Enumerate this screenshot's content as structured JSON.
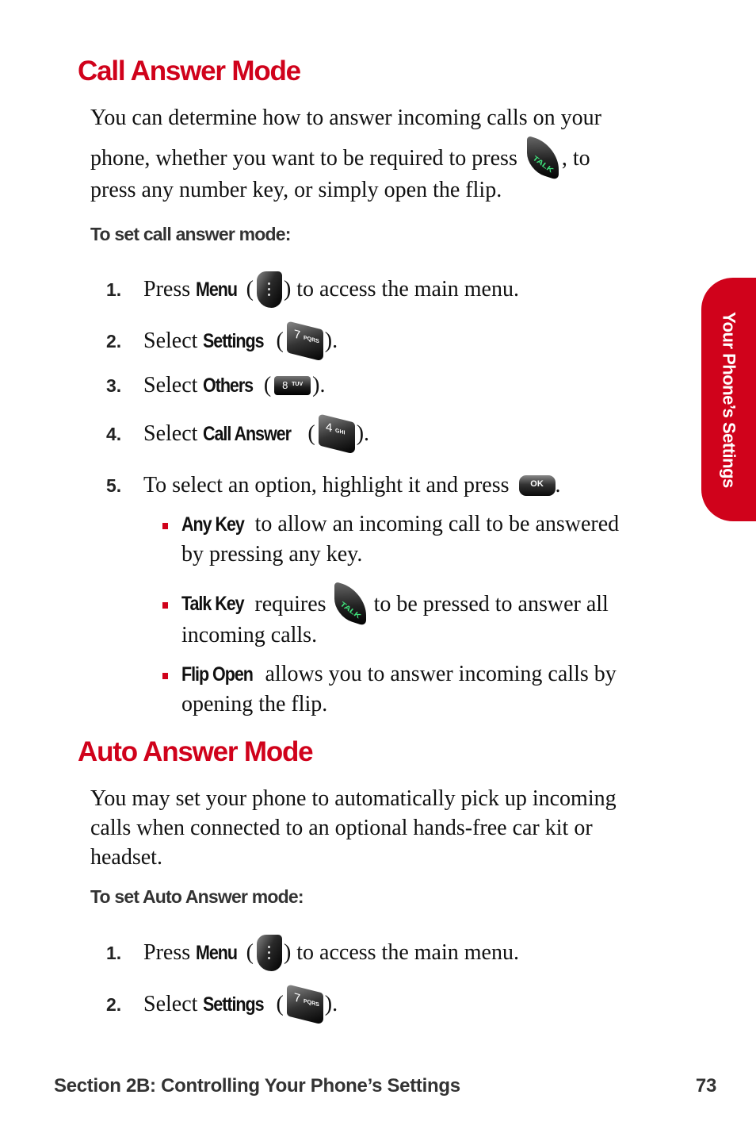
{
  "section1": {
    "title": "Call Answer Mode",
    "intro_line1": "You can determine how to answer incoming calls on your",
    "intro_line2_before": "phone, whether you want to be required to press",
    "intro_line2_after": ", to",
    "intro_line3": "press any number key, or simply open the flip.",
    "subheading": "To set call answer mode:",
    "steps": [
      {
        "num": "1.",
        "before": "Press",
        "bold": "Menu",
        "after": ") to access the main menu.",
        "icon": "menu-key-icon"
      },
      {
        "num": "2.",
        "before": "Select",
        "bold": "Settings",
        "after": ").",
        "icon": "key-7-pqrs-icon",
        "key_digit": "7",
        "key_letters": "PQRS"
      },
      {
        "num": "3.",
        "before": "Select",
        "bold": "Others",
        "after": ").",
        "icon": "key-8-tuv-icon",
        "key_digit": "8",
        "key_letters": "TUV"
      },
      {
        "num": "4.",
        "before": "Select",
        "bold": "Call Answer",
        "after": ").",
        "icon": "key-4-ghi-icon",
        "key_digit": "4",
        "key_letters": "GHI"
      },
      {
        "num": "5.",
        "before": "To select an option, highlight it and press",
        "after": ".",
        "icon": "ok-key-icon",
        "key_label": "OK"
      }
    ],
    "options": [
      {
        "bold": "Any Key",
        "line1": "to allow an incoming call to be answered",
        "line2": "by pressing any key."
      },
      {
        "bold": "Talk Key",
        "line1_before": "requires",
        "line1_after": "to be pressed to answer all",
        "line2": "incoming calls."
      },
      {
        "bold": "Flip Open",
        "line1": "allows you to answer incoming calls by",
        "line2": "opening the flip."
      }
    ]
  },
  "section2": {
    "title": "Auto Answer Mode",
    "intro_line1": "You may set your phone to automatically pick up incoming",
    "intro_line2": "calls when connected to an optional hands-free car kit or",
    "intro_line3": "headset.",
    "subheading": "To set Auto Answer mode:",
    "steps": [
      {
        "num": "1.",
        "before": "Press",
        "bold": "Menu",
        "after": ") to access the main menu.",
        "icon": "menu-key-icon"
      },
      {
        "num": "2.",
        "before": "Select",
        "bold": "Settings",
        "after": ").",
        "icon": "key-7-pqrs-icon",
        "key_digit": "7",
        "key_letters": "PQRS"
      }
    ]
  },
  "icons": {
    "talk_label": "TALK"
  },
  "side_tab": {
    "label": "Your Phone’s Settings",
    "color": "#d0021b"
  },
  "footer": {
    "section": "Section 2B: Controlling Your Phone’s Settings",
    "page_number": "73"
  },
  "colors": {
    "accent": "#d0021b",
    "text": "#111111",
    "subheading": "#333333"
  }
}
